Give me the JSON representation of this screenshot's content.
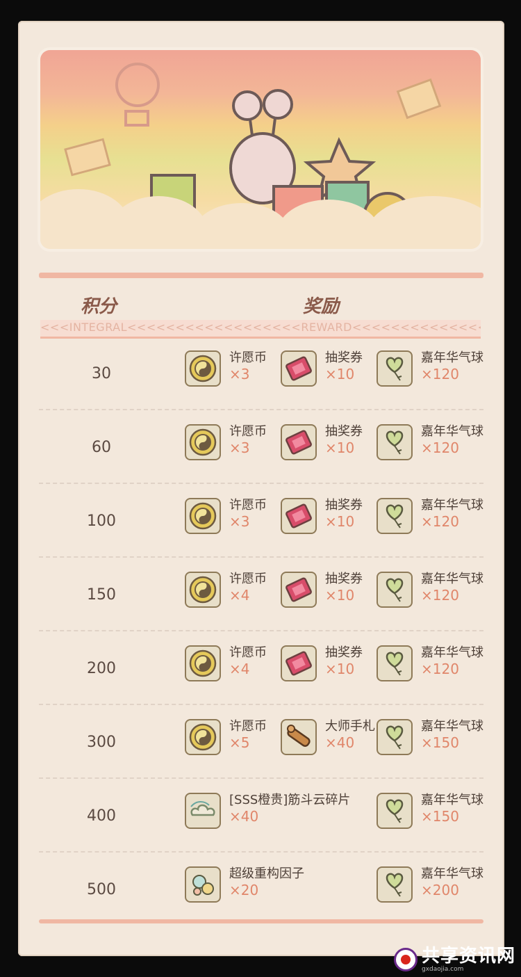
{
  "header": {
    "points_label": "积分",
    "reward_label": "奖励",
    "sub_label": "<<<INTEGRAL<<<<<<<<<<<<<<<<<<REWARD<<<<<<<<<<<<<<<"
  },
  "rows": [
    {
      "points": "30",
      "items": [
        {
          "icon": "yin-yang-coin-icon",
          "name": "许愿币",
          "qty": "×3"
        },
        {
          "icon": "ticket-icon",
          "name": "抽奖券",
          "qty": "×10"
        },
        {
          "icon": "heart-balloon-icon",
          "name": "嘉年华气球",
          "qty": "×120"
        }
      ]
    },
    {
      "points": "60",
      "items": [
        {
          "icon": "yin-yang-coin-icon",
          "name": "许愿币",
          "qty": "×3"
        },
        {
          "icon": "ticket-icon",
          "name": "抽奖券",
          "qty": "×10"
        },
        {
          "icon": "heart-balloon-icon",
          "name": "嘉年华气球",
          "qty": "×120"
        }
      ]
    },
    {
      "points": "100",
      "items": [
        {
          "icon": "yin-yang-coin-icon",
          "name": "许愿币",
          "qty": "×3"
        },
        {
          "icon": "ticket-icon",
          "name": "抽奖券",
          "qty": "×10"
        },
        {
          "icon": "heart-balloon-icon",
          "name": "嘉年华气球",
          "qty": "×120"
        }
      ]
    },
    {
      "points": "150",
      "items": [
        {
          "icon": "yin-yang-coin-icon",
          "name": "许愿币",
          "qty": "×4"
        },
        {
          "icon": "ticket-icon",
          "name": "抽奖券",
          "qty": "×10"
        },
        {
          "icon": "heart-balloon-icon",
          "name": "嘉年华气球",
          "qty": "×120"
        }
      ]
    },
    {
      "points": "200",
      "items": [
        {
          "icon": "yin-yang-coin-icon",
          "name": "许愿币",
          "qty": "×4"
        },
        {
          "icon": "ticket-icon",
          "name": "抽奖券",
          "qty": "×10"
        },
        {
          "icon": "heart-balloon-icon",
          "name": "嘉年华气球",
          "qty": "×120"
        }
      ]
    },
    {
      "points": "300",
      "items": [
        {
          "icon": "yin-yang-coin-icon",
          "name": "许愿币",
          "qty": "×5"
        },
        {
          "icon": "scroll-icon",
          "name": "大师手札",
          "qty": "×40"
        },
        {
          "icon": "heart-balloon-icon",
          "name": "嘉年华气球",
          "qty": "×150"
        }
      ]
    },
    {
      "points": "400",
      "items": [
        {
          "icon": "cloud-fragment-icon",
          "name": "[SSS橙贵]筋斗云碎片",
          "qty": "×40"
        },
        {
          "icon": "heart-balloon-icon",
          "name": "嘉年华气球",
          "qty": "×150"
        }
      ]
    },
    {
      "points": "500",
      "items": [
        {
          "icon": "bubbles-icon",
          "name": "超级重构因子",
          "qty": "×20"
        },
        {
          "icon": "heart-balloon-icon",
          "name": "嘉年华气球",
          "qty": "×200"
        }
      ]
    }
  ],
  "watermark": {
    "title": "共享资讯网",
    "domain": "gxdaojia.com"
  },
  "colors": {
    "panel_bg": "#f3e8dc",
    "accent_line": "#f0b7a3",
    "qty_orange": "#e0866a",
    "tile_border": "#8e7a58"
  }
}
